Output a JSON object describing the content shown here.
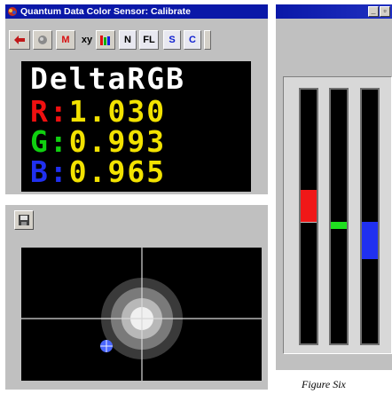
{
  "sensor_window": {
    "title": "Quantum Data Color Sensor: Calibrate",
    "toolbar": [
      {
        "icon": "arrow-left-icon",
        "name": "back-button"
      },
      {
        "icon": "record-dot-icon",
        "name": "record-button"
      },
      {
        "label": "M",
        "color": "#d81010",
        "name": "mode-m-button"
      },
      {
        "label": "xy",
        "color": "#000000",
        "name": "xy-button"
      },
      {
        "icon": "rgb-bars-icon",
        "name": "rgb-bars-button"
      },
      {
        "label": "N",
        "color": "#000000",
        "name": "n-button"
      },
      {
        "label": "FL",
        "color": "#000000",
        "name": "fl-button"
      },
      {
        "label": "S",
        "color": "#1020d0",
        "name": "s-button"
      },
      {
        "label": "C",
        "color": "#1020d0",
        "name": "c-button"
      }
    ],
    "readout": {
      "title": "DeltaRGB",
      "r": {
        "label": "R:",
        "value": "1.030",
        "color": "#f01010"
      },
      "g": {
        "label": "G:",
        "value": "0.993",
        "color": "#10d010"
      },
      "b": {
        "label": "B:",
        "value": "0.965",
        "color": "#2030f0"
      }
    }
  },
  "bars_window": {
    "bars": [
      {
        "name": "red",
        "color": "#f01818",
        "value": 1.03
      },
      {
        "name": "green",
        "color": "#20e020",
        "value": 0.993
      },
      {
        "name": "blue",
        "color": "#2030f0",
        "value": 0.965
      }
    ]
  },
  "target_window": {
    "pin_icon": "floppy-disk-icon",
    "point_marker": "crosshair-dot-icon"
  },
  "caption": "Figure Six"
}
